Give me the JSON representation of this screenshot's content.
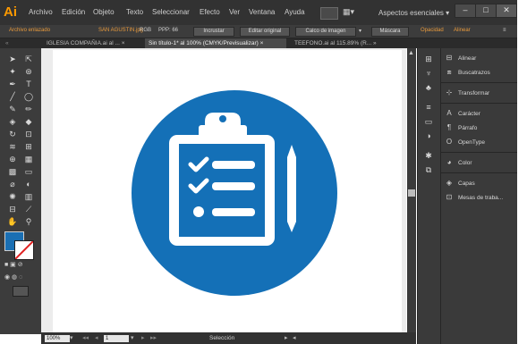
{
  "app_logo": "Ai",
  "menu": [
    "Archivo",
    "Edición",
    "Objeto",
    "Texto",
    "Seleccionar",
    "Efecto",
    "Ver",
    "Ventana",
    "Ayuda"
  ],
  "workspace": "Aspectos esenciales",
  "window_controls": [
    "–",
    "□",
    "✕"
  ],
  "control_bar": {
    "linked_file": "Archivo enlazado",
    "filename": "SAN AGUSTIN.jpg",
    "color_mode": "RGB",
    "ppp": "PPP: 66",
    "embed_button": "Incrustar",
    "edit_original_button": "Editar original",
    "image_trace_button": "Calco de imagen",
    "mask_button": "Máscara",
    "opacity_label": "Opacidad",
    "align_label": "Alinear"
  },
  "tabs": [
    {
      "label": "IGLESIA COMPAÑIA.ai al ...",
      "close": "×"
    },
    {
      "label": "Sin título-1* al 100% (CMYK/Previsualizar)",
      "close": "×"
    },
    {
      "label": "TEEFONO.ai al 115.89% (R...",
      "close": "»"
    }
  ],
  "status": {
    "zoom": "100%",
    "artboard_number": "1",
    "mode": "Selección"
  },
  "panels": [
    {
      "label": "Alinear",
      "icon": "align-icon"
    },
    {
      "label": "Buscatrazos",
      "icon": "pathfinder-icon"
    },
    {
      "label": "Transformar",
      "icon": "transform-icon"
    },
    {
      "label": "Carácter",
      "icon": "character-icon"
    },
    {
      "label": "Párrafo",
      "icon": "paragraph-icon"
    },
    {
      "label": "OpenType",
      "icon": "opentype-icon"
    },
    {
      "label": "Color",
      "icon": "color-icon"
    },
    {
      "label": "Capas",
      "icon": "layers-icon"
    },
    {
      "label": "Mesas de traba...",
      "icon": "artboards-icon"
    }
  ],
  "colors": {
    "fill": "#1a6fb3",
    "badge": "#1470b7",
    "illustration": "#ffffff"
  },
  "artwork_icon": "clipboard-checklist-icon"
}
